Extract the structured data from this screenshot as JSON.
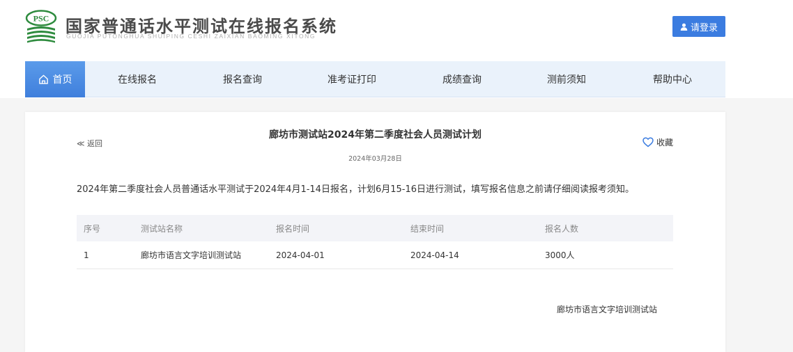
{
  "header": {
    "logo_text": "PSC",
    "title": "国家普通话水平测试在线报名系统",
    "subtitle": "GUOJIA PUTONGHUA SHUIPING CESHI ZAIXIAN BAOMING XITONG",
    "login_label": "请登录"
  },
  "nav": {
    "items": [
      {
        "label": "首页"
      },
      {
        "label": "在线报名"
      },
      {
        "label": "报名查询"
      },
      {
        "label": "准考证打印"
      },
      {
        "label": "成绩查询"
      },
      {
        "label": "测前须知"
      },
      {
        "label": "帮助中心"
      }
    ]
  },
  "article": {
    "back_label": "≪ 返回",
    "title": "廊坊市测试站2024年第二季度社会人员测试计划",
    "date": "2024年03月28日",
    "favorite_label": "收藏",
    "intro": "2024年第二季度社会人员普通话水平测试于2024年4月1-14日报名，计划6月15-16日进行测试，填写报名信息之前请仔细阅读报考须知。",
    "table": {
      "headers": [
        "序号",
        "测试站名称",
        "报名时间",
        "结束时间",
        "报名人数"
      ],
      "rows": [
        [
          "1",
          "廊坊市语言文字培训测试站",
          "2024-04-01",
          "2024-04-14",
          "3000人"
        ]
      ]
    },
    "signature": "廊坊市语言文字培训测试站"
  },
  "colors": {
    "accent": "#3b7ce0",
    "logo_green": "#2e8b3e",
    "nav_bg": "#eaf2fb"
  }
}
